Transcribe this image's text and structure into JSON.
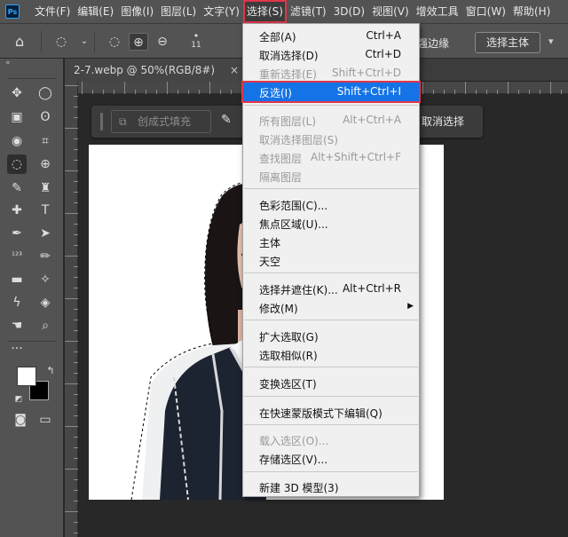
{
  "app": {
    "logo_text": "Ps"
  },
  "menubar": {
    "items": [
      "文件(F)",
      "编辑(E)",
      "图像(I)",
      "图层(L)",
      "文字(Y)",
      "选择(S)",
      "滤镜(T)",
      "3D(D)",
      "视图(V)",
      "增效工具",
      "窗口(W)",
      "帮助(H)"
    ],
    "active_index": 5
  },
  "options": {
    "brush_size": "11",
    "edge_label": "强边缘",
    "subject_button": "选择主体"
  },
  "document": {
    "tab_title": "2-7.webp @ 50%(RGB/8#)",
    "close_glyph": "×"
  },
  "taskbar": {
    "fill_label": "创成式填充",
    "deselect_label": "取消选择"
  },
  "dropdown": {
    "items": [
      {
        "label": "全部(A)",
        "shortcut": "Ctrl+A",
        "enabled": true
      },
      {
        "label": "取消选择(D)",
        "shortcut": "Ctrl+D",
        "enabled": true
      },
      {
        "label": "重新选择(E)",
        "shortcut": "Shift+Ctrl+D",
        "enabled": false
      },
      {
        "label": "反选(I)",
        "shortcut": "Shift+Ctrl+I",
        "enabled": true,
        "highlighted": true
      },
      {
        "label": "所有图层(L)",
        "shortcut": "Alt+Ctrl+A",
        "enabled": false
      },
      {
        "label": "取消选择图层(S)",
        "shortcut": "",
        "enabled": false
      },
      {
        "label": "查找图层",
        "shortcut": "Alt+Shift+Ctrl+F",
        "enabled": false
      },
      {
        "label": "隔离图层",
        "shortcut": "",
        "enabled": false
      },
      {
        "label": "色彩范围(C)...",
        "shortcut": "",
        "enabled": true
      },
      {
        "label": "焦点区域(U)...",
        "shortcut": "",
        "enabled": true
      },
      {
        "label": "主体",
        "shortcut": "",
        "enabled": true
      },
      {
        "label": "天空",
        "shortcut": "",
        "enabled": true
      },
      {
        "label": "选择并遮住(K)...",
        "shortcut": "Alt+Ctrl+R",
        "enabled": true
      },
      {
        "label": "修改(M)",
        "shortcut": "",
        "enabled": true,
        "submenu": true
      },
      {
        "label": "扩大选取(G)",
        "shortcut": "",
        "enabled": true
      },
      {
        "label": "选取相似(R)",
        "shortcut": "",
        "enabled": true
      },
      {
        "label": "变换选区(T)",
        "shortcut": "",
        "enabled": true
      },
      {
        "label": "在快速蒙版模式下编辑(Q)",
        "shortcut": "",
        "enabled": true
      },
      {
        "label": "载入选区(O)...",
        "shortcut": "",
        "enabled": false
      },
      {
        "label": "存储选区(V)...",
        "shortcut": "",
        "enabled": true
      },
      {
        "label": "新建 3D 模型(3)",
        "shortcut": "",
        "enabled": true
      }
    ]
  },
  "toolbar": {
    "tools": [
      [
        "move-icon",
        "marquee-icon"
      ],
      [
        "artboard-icon",
        "lasso-icon"
      ],
      [
        "object-select-icon",
        "crop-icon"
      ],
      [
        "quick-select-icon",
        "eyedropper-target-icon"
      ],
      [
        "brush-icon",
        "stamp-icon"
      ],
      [
        "healing-icon",
        "type-icon"
      ],
      [
        "pen-icon",
        "path-select-icon"
      ],
      [
        "count-icon",
        "ruler-icon"
      ],
      [
        "ruler-tool-icon",
        "magic-wand-icon"
      ],
      [
        "eyedropper-icon",
        "eraser-icon"
      ],
      [
        "hand-icon",
        "zoom-icon"
      ]
    ],
    "selected_row": 3
  },
  "colors": {
    "menu_highlight": "#1473e6",
    "annotation_red": "#e0354a",
    "foreground_swatch": "#ffffff",
    "background_swatch": "#000000"
  }
}
